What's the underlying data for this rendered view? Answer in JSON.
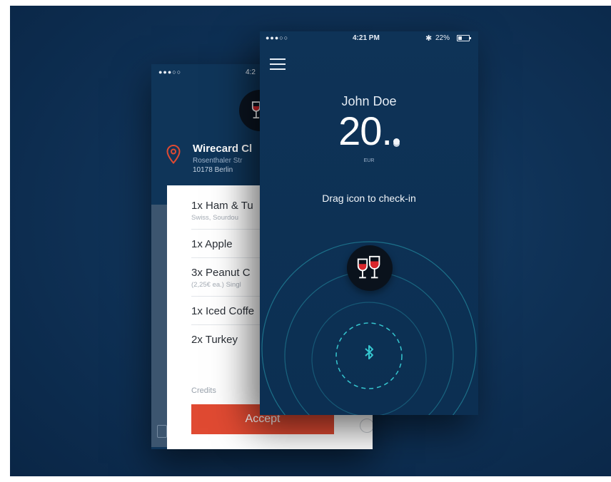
{
  "back_screen": {
    "status": {
      "signal": "●●●○○",
      "time": "4:2"
    },
    "venue": {
      "name": "Wirecard Cl",
      "street": "Rosenthaler Str",
      "city": "10178 Berlin"
    },
    "order_items": [
      {
        "name": "1x Ham & Tu",
        "detail": "Swiss, Sourdou"
      },
      {
        "name": "1x Apple",
        "detail": ""
      },
      {
        "name": "3x Peanut C",
        "detail": "(2,25€ ea.) Singl"
      },
      {
        "name": "1x Iced Coffe",
        "detail": ""
      },
      {
        "name": "2x Turkey",
        "detail": ""
      }
    ],
    "credits_label": "Credits",
    "accept_label": "Accept",
    "colors": {
      "accent": "#e04a32"
    }
  },
  "front_screen": {
    "status": {
      "signal": "●●●○○",
      "time": "4:21 PM",
      "bluetooth": "✱",
      "battery": "22%"
    },
    "user_name": "John Doe",
    "balance": "20.",
    "currency": "EUR",
    "instruction": "Drag icon to check-in",
    "icons": {
      "menu": "menu-icon",
      "checkin": "wine-glasses-icon",
      "target": "bluetooth-icon"
    },
    "colors": {
      "ring": "#2aa6b6",
      "bluetooth": "#35c6cf"
    }
  }
}
